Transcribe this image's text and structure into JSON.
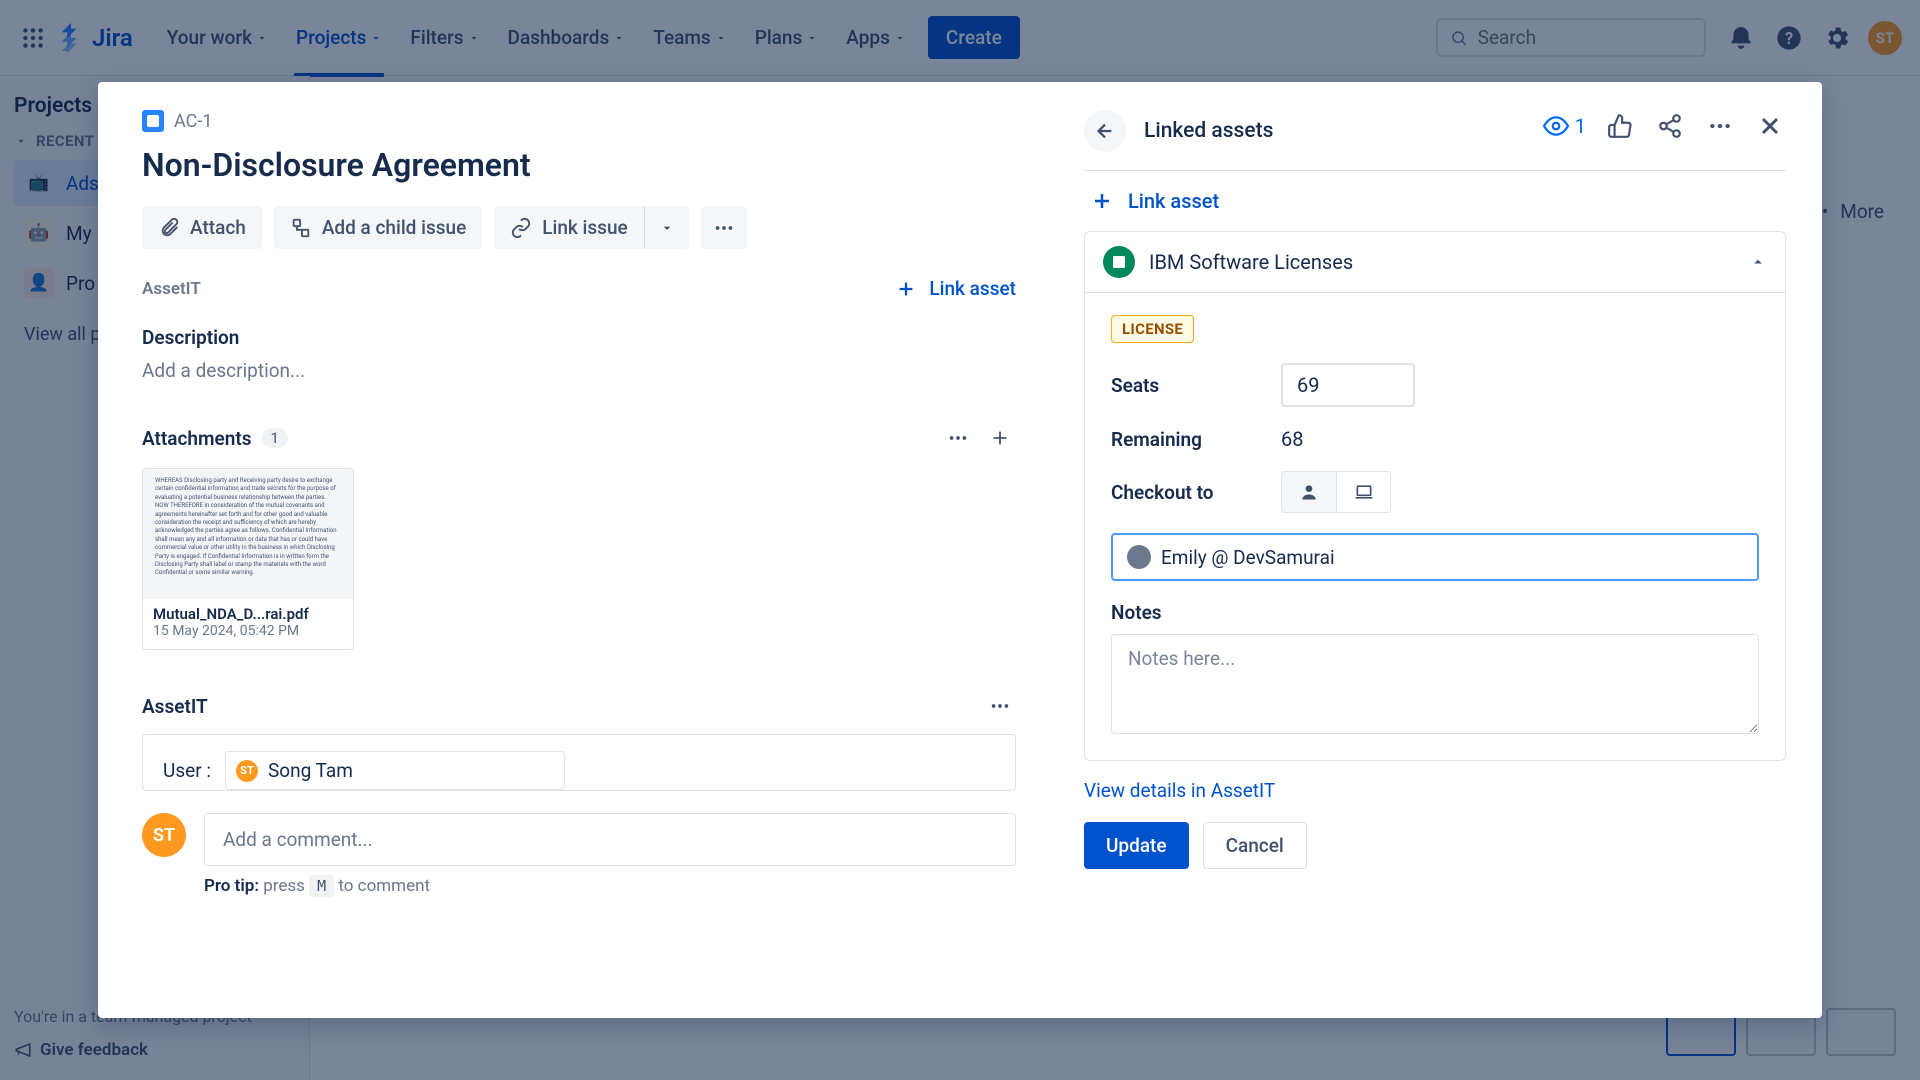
{
  "nav": {
    "logo": "Jira",
    "links": [
      "Your work",
      "Projects",
      "Filters",
      "Dashboards",
      "Teams",
      "Plans",
      "Apps"
    ],
    "active_index": 1,
    "create": "Create",
    "search_placeholder": "Search",
    "avatar": "ST"
  },
  "sidebar": {
    "title": "Projects",
    "group": "RECENT",
    "items": [
      {
        "label": "Ads",
        "icon_bg": "#2684ff",
        "emoji": "📺"
      },
      {
        "label": "My",
        "icon_bg": "#ffc400",
        "emoji": "🤖"
      },
      {
        "label": "Pro",
        "icon_bg": "#ffebe6",
        "emoji": "👤"
      }
    ],
    "view_all": "View all p",
    "footer_text": "You're in a team-managed project",
    "feedback": "Give feedback"
  },
  "bg_more": "More",
  "modal": {
    "issue_key": "AC-1",
    "watch_count": "1",
    "title": "Non-Disclosure Agreement",
    "actions": {
      "attach": "Attach",
      "add_child": "Add a child issue",
      "link_issue": "Link issue"
    },
    "assetit_label": "AssetIT",
    "link_asset_inline": "Link asset",
    "description": {
      "heading": "Description",
      "placeholder": "Add a description..."
    },
    "attachments": {
      "heading": "Attachments",
      "count": "1",
      "file_name": "Mutual_NDA_D...rai.pdf",
      "file_date": "15 May 2024, 05:42 PM",
      "thumb_text": "WHEREAS Disclosing party and Receiving party desire to exchange certain confidential information and trade secrets for the purpose of evaluating a potential business relationship between the parties. NOW THEREFORE in consideration of the mutual covenants and agreements hereinafter set forth and for other good and valuable consideration the receipt and sufficiency of which are hereby acknowledged the parties agree as follows. Confidential Information shall mean any and all information or data that has or could have commercial value or other utility in the business in which Disclosing Party is engaged. If Confidential Information is in written form the Disclosing Party shall label or stamp the materials with the word Confidential or some similar warning."
    },
    "assetit_panel": {
      "heading": "AssetIT",
      "user_label": "User :",
      "user_name": "Song Tam",
      "user_initials": "ST"
    },
    "comment": {
      "avatar": "ST",
      "placeholder": "Add a comment...",
      "protip_label": "Pro tip:",
      "protip_1": "press",
      "protip_key": "M",
      "protip_2": "to comment"
    }
  },
  "right": {
    "linked_assets": "Linked assets",
    "link_asset": "Link asset",
    "asset_name": "IBM Software Licenses",
    "badge": "LICENSE",
    "seats_label": "Seats",
    "seats_value": "69",
    "remaining_label": "Remaining",
    "remaining_value": "68",
    "checkout_label": "Checkout to",
    "checkout_value": "Emily @ DevSamurai",
    "notes_label": "Notes",
    "notes_placeholder": "Notes here...",
    "view_details": "View details in AssetIT",
    "update": "Update",
    "cancel": "Cancel"
  }
}
